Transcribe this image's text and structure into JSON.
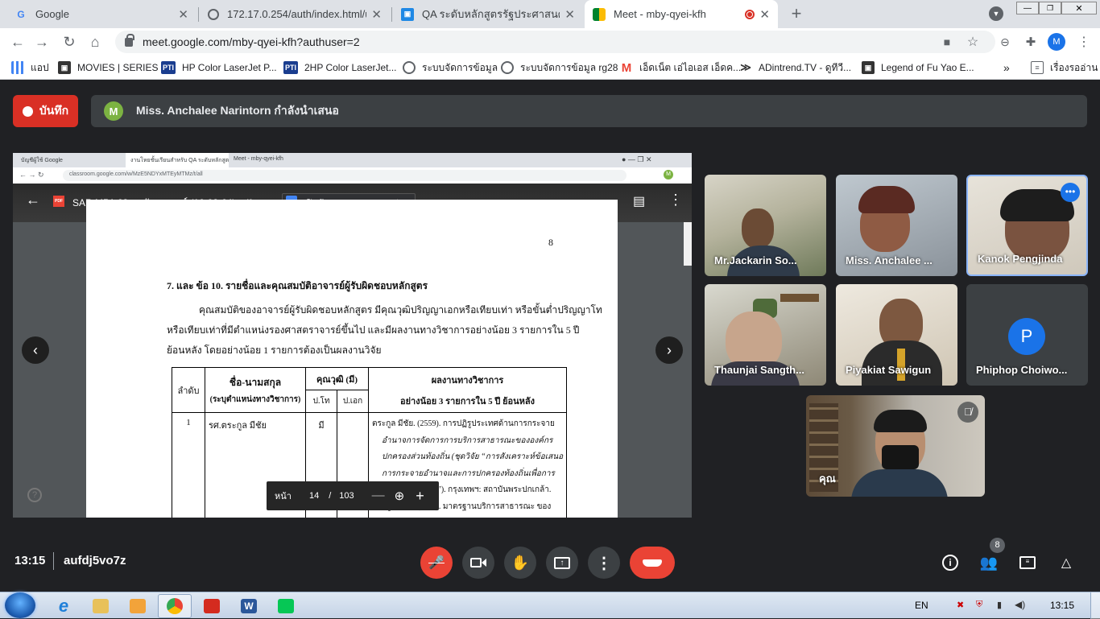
{
  "browser": {
    "tabs": [
      {
        "title": "Google",
        "icon": "google-icon"
      },
      {
        "title": "172.17.0.254/auth/index.html/u",
        "icon": "globe-icon"
      },
      {
        "title": "QA ระดับหลักสูตรรัฐประศาสนศาสตรม",
        "icon": "classroom-icon"
      },
      {
        "title": "Meet - mby-qyei-kfh",
        "icon": "meet-icon"
      }
    ],
    "url": "meet.google.com/mby-qyei-kfh?authuser=2",
    "profile_initial": "M",
    "bookmarks": [
      {
        "label": "แอป",
        "icon": "apps-grid-icon"
      },
      {
        "label": "MOVIES | SERIES",
        "icon": "film-icon"
      },
      {
        "label": "HP Color LaserJet P...",
        "icon": "pti-icon"
      },
      {
        "label": "2HP Color LaserJet...",
        "icon": "pti-icon"
      },
      {
        "label": "ระบบจัดการข้อมูล",
        "icon": "globe-icon"
      },
      {
        "label": "ระบบจัดการข้อมูล rg28",
        "icon": "globe-icon"
      },
      {
        "label": "เอ็ดเน็ต เอ่ไอเอส เอ็ดค...",
        "icon": "gmail-icon"
      },
      {
        "label": "ADintrend.TV - ดูทีวี...",
        "icon": "adintrend-icon"
      },
      {
        "label": "Legend of Fu Yao E...",
        "icon": "film-icon"
      }
    ],
    "reading_list": "เรื่องรออ่าน"
  },
  "meet": {
    "record_label": "บันทึก",
    "presenter_initial": "M",
    "presenter_text": "Miss. Anchalee Narintorn กำลังนำเสนอ",
    "time": "13:15",
    "meeting_code": "aufdj5vo7z",
    "participant_count": "8",
    "colors": {
      "end_call": "#ea4335",
      "mic_off": "#ea4335",
      "record": "#d93025"
    }
  },
  "shared": {
    "inner_tabs": [
      "บัญชีผู้ใช้ Google",
      "งานโหยชั้นเรียนสำหรับ QA ระดับหลักสูต",
      "Meet - mby-qyei-kfh"
    ],
    "inner_url": "classroom.google.com/w/MzE5NDYxMTEyMTMz/t/all",
    "inner_profile": "M",
    "pdf_name": "SAR MPA 63 _ฉบับสมบูรณ์ (16-08-64).pdf",
    "open_with": "เปิดด้วย Google เอกสาร",
    "page_number": "8",
    "heading": "7. และ ข้อ 10. รายชื่อและคุณสมบัติอาจารย์ผู้รับผิดชอบหลักสูตร",
    "para1": "คุณสมบัติของอาจารย์ผู้รับผิดชอบหลักสูตร มีคุณวุฒิปริญญาเอกหรือเทียบเท่า หรือขั้นต่ำปริญญาโท",
    "para2": "หรือเทียบเท่าที่มีตำแหน่งรองศาสตราจารย์ขึ้นไป และมีผลงานทางวิชาการอย่างน้อย 3 รายการใน 5 ปี",
    "para3": "ย้อนหลัง โดยอย่างน้อย 1 รายการต้องเป็นผลงานวิจัย",
    "table": {
      "h_order": "ลำดับ",
      "h_name1": "ชื่อ-นามสกุล",
      "h_name2": "(ระบุตำแหน่งทางวิชาการ)",
      "h_qual": "คุณวุฒิ (มี)",
      "h_ma": "ป.โท",
      "h_phd": "ป.เอก",
      "h_works1": "ผลงานทางวิชาการ",
      "h_works2": "อย่างน้อย 3 รายการใน 5 ปี ย้อนหลัง",
      "r_order": "1",
      "r_name": "รศ.ตระกูล มีชัย",
      "r_ma": "มี",
      "r_works": [
        "ตระกูล มีชัย. (2559). การปฏิรูประเทศด้านการกระจาย",
        "อำนาจการจัดการการบริการสาธารณะขององค์กร",
        "ปกครองส่วนท้องถิ่น (ชุดวิจัย “การสังเคราะห์ข้อเสนอ",
        "การกระจายอำนาจและการปกครองท้องถิ่นเพื่อการ",
        "ปฏิรูประเทศไทย”). กรุงเทพฯ: สถาบันพระปกเกล้า.",
        "ตระกูล มีชัย. (2560). มาตรฐานบริการสาธารณะ  ของ"
      ]
    },
    "pager": {
      "label": "หน้า",
      "current": "14",
      "sep": "/",
      "total": "103"
    }
  },
  "participants": [
    {
      "name": "Mr.Jackarin So..."
    },
    {
      "name": "Miss. Anchalee ..."
    },
    {
      "name": "Kanok Pengjinda"
    },
    {
      "name": "Thaunjai Sangth..."
    },
    {
      "name": "Piyakiat Sawigun"
    },
    {
      "name": "Phiphop Choiwo...",
      "initial": "P"
    },
    {
      "name": "คุณ"
    }
  ],
  "taskbar": {
    "lang": "EN",
    "clock": "13:15"
  }
}
